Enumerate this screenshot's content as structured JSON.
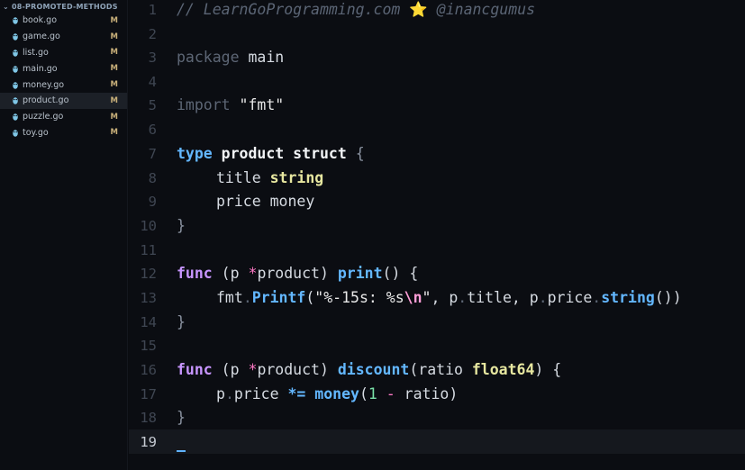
{
  "sidebar": {
    "folder": "08-PROMOTED-METHODS",
    "files": [
      {
        "name": "book.go",
        "status": "M"
      },
      {
        "name": "game.go",
        "status": "M"
      },
      {
        "name": "list.go",
        "status": "M"
      },
      {
        "name": "main.go",
        "status": "M"
      },
      {
        "name": "money.go",
        "status": "M"
      },
      {
        "name": "product.go",
        "status": "M"
      },
      {
        "name": "puzzle.go",
        "status": "M"
      },
      {
        "name": "toy.go",
        "status": "M"
      }
    ]
  },
  "editor": {
    "line_numbers": [
      "1",
      "2",
      "3",
      "4",
      "5",
      "6",
      "7",
      "8",
      "9",
      "10",
      "11",
      "12",
      "13",
      "14",
      "15",
      "16",
      "17",
      "18",
      "19"
    ],
    "comment": "// LearnGoProgramming.com ",
    "comment_star": "⭐",
    "comment_author": " @inancgumus",
    "package_kw": "package",
    "package_name": " main",
    "import_kw": "import",
    "import_path": " \"fmt\"",
    "type_kw": "type",
    "struct_name": " product",
    "struct_kw": " struct",
    "open_brace": " {",
    "field_title": "title",
    "field_title_type": " string",
    "field_price": "price money",
    "close_brace": "}",
    "func_kw": "func",
    "recv_open": " (p ",
    "star_op": "*",
    "recv_type": "product)",
    "print_fn": " print",
    "print_parens": "() {",
    "fmt_pkg": "fmt",
    "dot": ".",
    "printf_fn": "Printf",
    "printf_open": "(",
    "fmt_str_a": "\"%-15s: %s",
    "fmt_esc": "\\n",
    "fmt_str_b": "\"",
    "printf_args_a": ", p",
    "printf_args_b": "title, p",
    "printf_args_c": "price",
    "string_fn": "string",
    "printf_close": "())",
    "discount_fn": " discount",
    "discount_open": "(ratio ",
    "float_type": "float64",
    "discount_close": ") {",
    "p_var": "p",
    "price_field": "price ",
    "mul_assign": "*=",
    "money_fn": " money",
    "paren_open": "(",
    "one": "1",
    "minus": " - ",
    "ratio_close": "ratio)"
  }
}
